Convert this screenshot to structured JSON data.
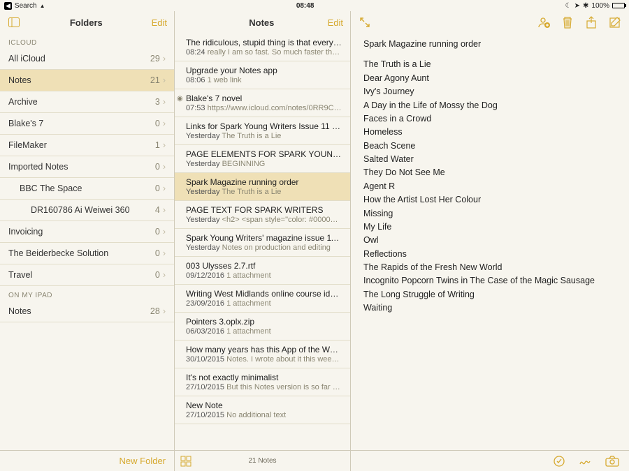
{
  "status": {
    "back": "Search",
    "time": "08:48",
    "battery_pct": "100%"
  },
  "folders": {
    "title": "Folders",
    "edit": "Edit",
    "sections": [
      {
        "header": "ICLOUD",
        "items": [
          {
            "label": "All iCloud",
            "count": "29",
            "indent": 0
          },
          {
            "label": "Notes",
            "count": "21",
            "indent": 0,
            "selected": true
          },
          {
            "label": "Archive",
            "count": "3",
            "indent": 0
          },
          {
            "label": "Blake's 7",
            "count": "0",
            "indent": 0
          },
          {
            "label": "FileMaker",
            "count": "1",
            "indent": 0
          },
          {
            "label": "Imported Notes",
            "count": "0",
            "indent": 0
          },
          {
            "label": "BBC The Space",
            "count": "0",
            "indent": 1
          },
          {
            "label": "DR160786 Ai Weiwei 360",
            "count": "4",
            "indent": 2
          },
          {
            "label": "Invoicing",
            "count": "0",
            "indent": 0
          },
          {
            "label": "The Beiderbecke Solution",
            "count": "0",
            "indent": 0
          },
          {
            "label": "Travel",
            "count": "0",
            "indent": 0
          }
        ]
      },
      {
        "header": "ON MY IPAD",
        "items": [
          {
            "label": "Notes",
            "count": "28",
            "indent": 0
          }
        ]
      }
    ],
    "new_folder": "New Folder"
  },
  "notes": {
    "title": "Notes",
    "edit": "Edit",
    "items": [
      {
        "title": "The ridiculous, stupid thing is that every…",
        "time": "08:24",
        "snippet": "really I am so fast. So much faster tha…"
      },
      {
        "title": "Upgrade your Notes app",
        "time": "08:06",
        "snippet": "1 web link"
      },
      {
        "title": "Blake's 7 novel",
        "time": "07:53",
        "snippet": "https://www.icloud.com/notes/0RR9C…",
        "shared": true
      },
      {
        "title": "Links for Spark Young Writers Issue 11 p…",
        "time": "Yesterday",
        "snippet": "The Truth is a Lie"
      },
      {
        "title": "PAGE ELEMENTS FOR SPARK YOUNG…",
        "time": "Yesterday",
        "snippet": "BEGINNING"
      },
      {
        "title": "Spark Magazine running order",
        "time": "Yesterday",
        "snippet": "The Truth is a Lie",
        "selected": true
      },
      {
        "title": "PAGE TEXT FOR SPARK WRITERS",
        "time": "Yesterday",
        "snippet": "<h2> <span style=\"color: #0000…"
      },
      {
        "title": "Spark Young Writers' magazine issue 11…",
        "time": "Yesterday",
        "snippet": "Notes on production and editing"
      },
      {
        "title": "003 Ulysses 2.7.rtf",
        "time": "09/12/2016",
        "snippet": "1 attachment"
      },
      {
        "title": "Writing West Midlands online course ide…",
        "time": "23/09/2016",
        "snippet": "1 attachment"
      },
      {
        "title": "Pointers 3.oplx.zip",
        "time": "06/03/2016",
        "snippet": "1 attachment"
      },
      {
        "title": "How many years has this App of the We…",
        "time": "30/10/2015",
        "snippet": "Notes. I wrote about it this week…"
      },
      {
        "title": "It's not exactly minimalist",
        "time": "27/10/2015",
        "snippet": "But this Notes version is so far r…"
      },
      {
        "title": "New Note",
        "time": "27/10/2015",
        "snippet": "No additional text"
      }
    ],
    "footer": "21 Notes"
  },
  "detail": {
    "title": "Spark Magazine running order",
    "lines": [
      "The Truth is a Lie",
      "Dear Agony Aunt",
      "Ivy's Journey",
      "A Day in the Life of Mossy the Dog",
      "Faces in a Crowd",
      "Homeless",
      "Beach Scene",
      "Salted Water",
      "They Do Not See Me",
      "Agent R",
      "How the Artist Lost Her Colour",
      "Missing",
      "My Life",
      "Owl",
      "Reflections",
      "The Rapids of the Fresh New World",
      "Incognito Popcorn Twins in The Case of the Magic Sausage",
      "The Long Struggle of Writing",
      "Waiting"
    ]
  }
}
